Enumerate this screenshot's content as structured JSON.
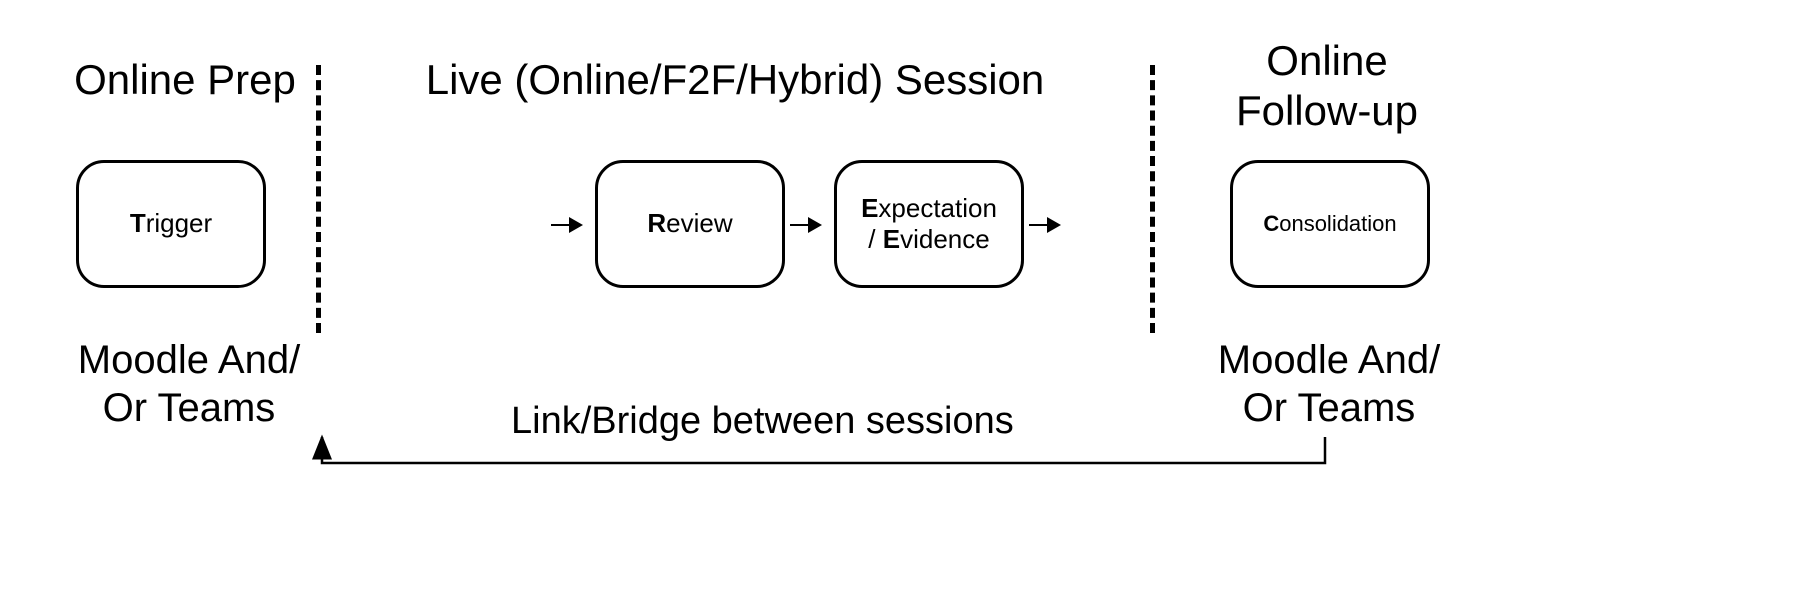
{
  "columns": {
    "left": {
      "heading": "Online Prep",
      "subheading": "Moodle And/\nOr Teams"
    },
    "middle": {
      "heading": "Live (Online/F2F/Hybrid) Session"
    },
    "right": {
      "heading": "Online\nFollow-up",
      "subheading": "Moodle And/\nOr Teams"
    }
  },
  "boxes": {
    "trigger": {
      "bold": "T",
      "rest": "rigger"
    },
    "review": {
      "bold": "R",
      "rest": "eview"
    },
    "expect_line1_bold": "E",
    "expect_line1_rest": "xpectation",
    "expect_line2_pre": "/ ",
    "expect_line2_bold": "E",
    "expect_line2_rest": "vidence",
    "consolidation": {
      "bold": "C",
      "rest": "onsolidation"
    }
  },
  "link_label": "Link/Bridge between sessions"
}
